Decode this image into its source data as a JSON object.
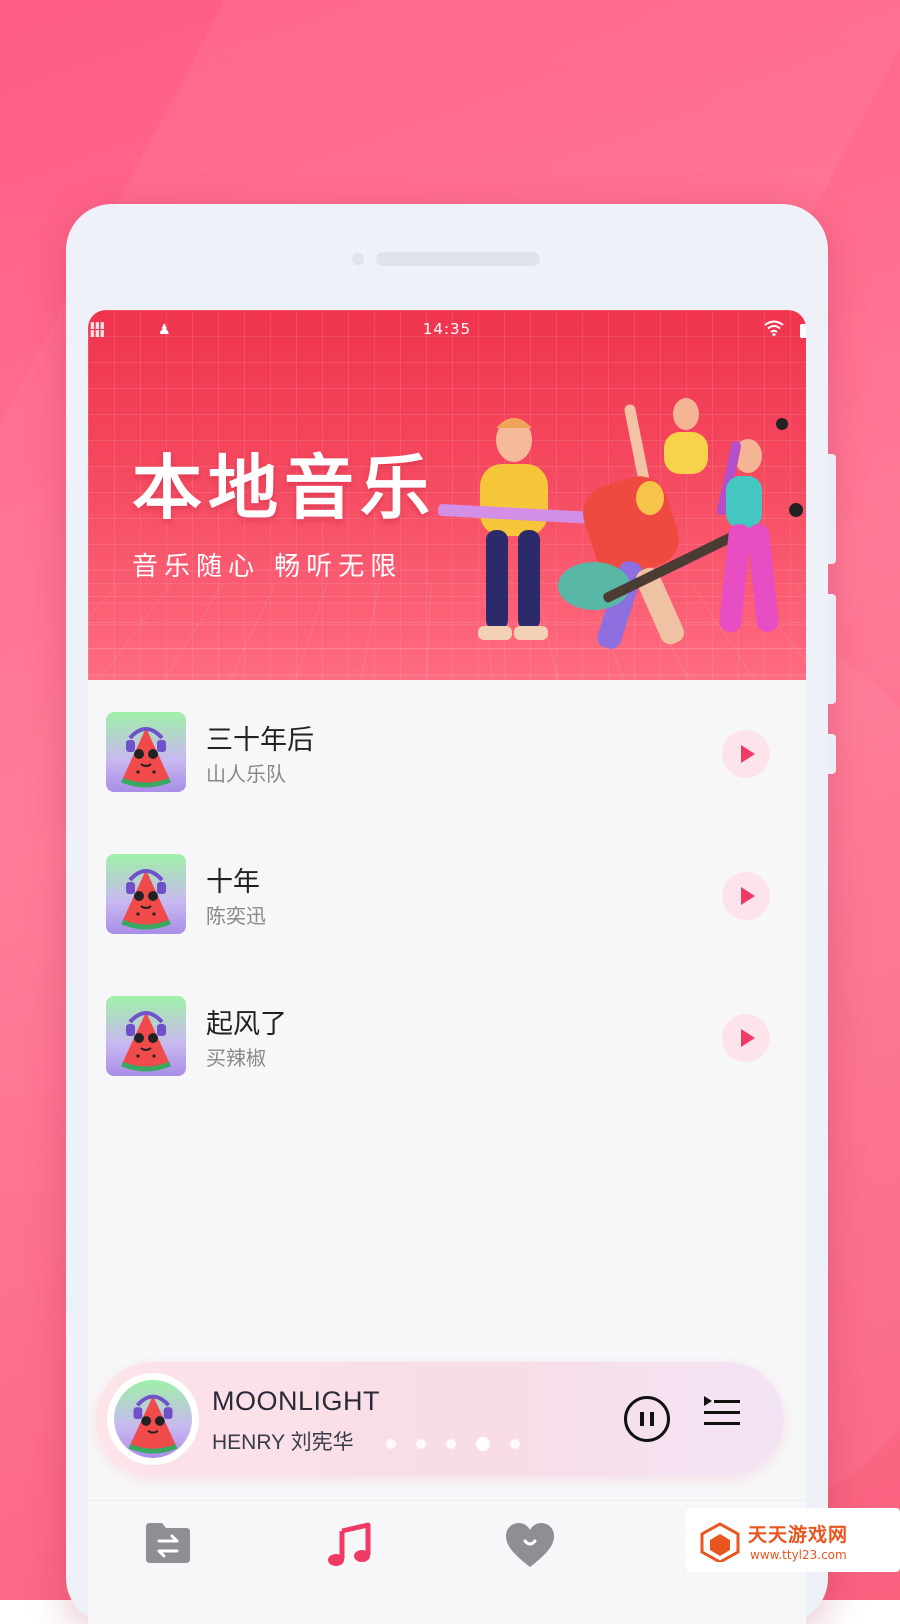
{
  "status_bar": {
    "time": "14:35"
  },
  "banner": {
    "title": "本地音乐",
    "subtitle": "音乐随心  畅听无限"
  },
  "songs": [
    {
      "title": "三十年后",
      "artist": "山人乐队"
    },
    {
      "title": "十年",
      "artist": "陈奕迅"
    },
    {
      "title": "起风了",
      "artist": "买辣椒"
    }
  ],
  "now_playing": {
    "title": "MOONLIGHT",
    "artist": "HENRY 刘宪华",
    "is_playing": true,
    "page_dots": 5,
    "active_dot": 3
  },
  "tab_bar": {
    "tabs": [
      {
        "icon": "folder-transfer-icon",
        "label": ""
      },
      {
        "icon": "music-note-icon",
        "label": "",
        "active": true
      },
      {
        "icon": "heart-icon",
        "label": ""
      }
    ]
  },
  "watermark": {
    "name": "天天游戏网",
    "url": "www.ttyl23.com"
  },
  "colors": {
    "accent": "#f03a66",
    "background": "#ff6a8c",
    "banner": "#f23c55"
  }
}
